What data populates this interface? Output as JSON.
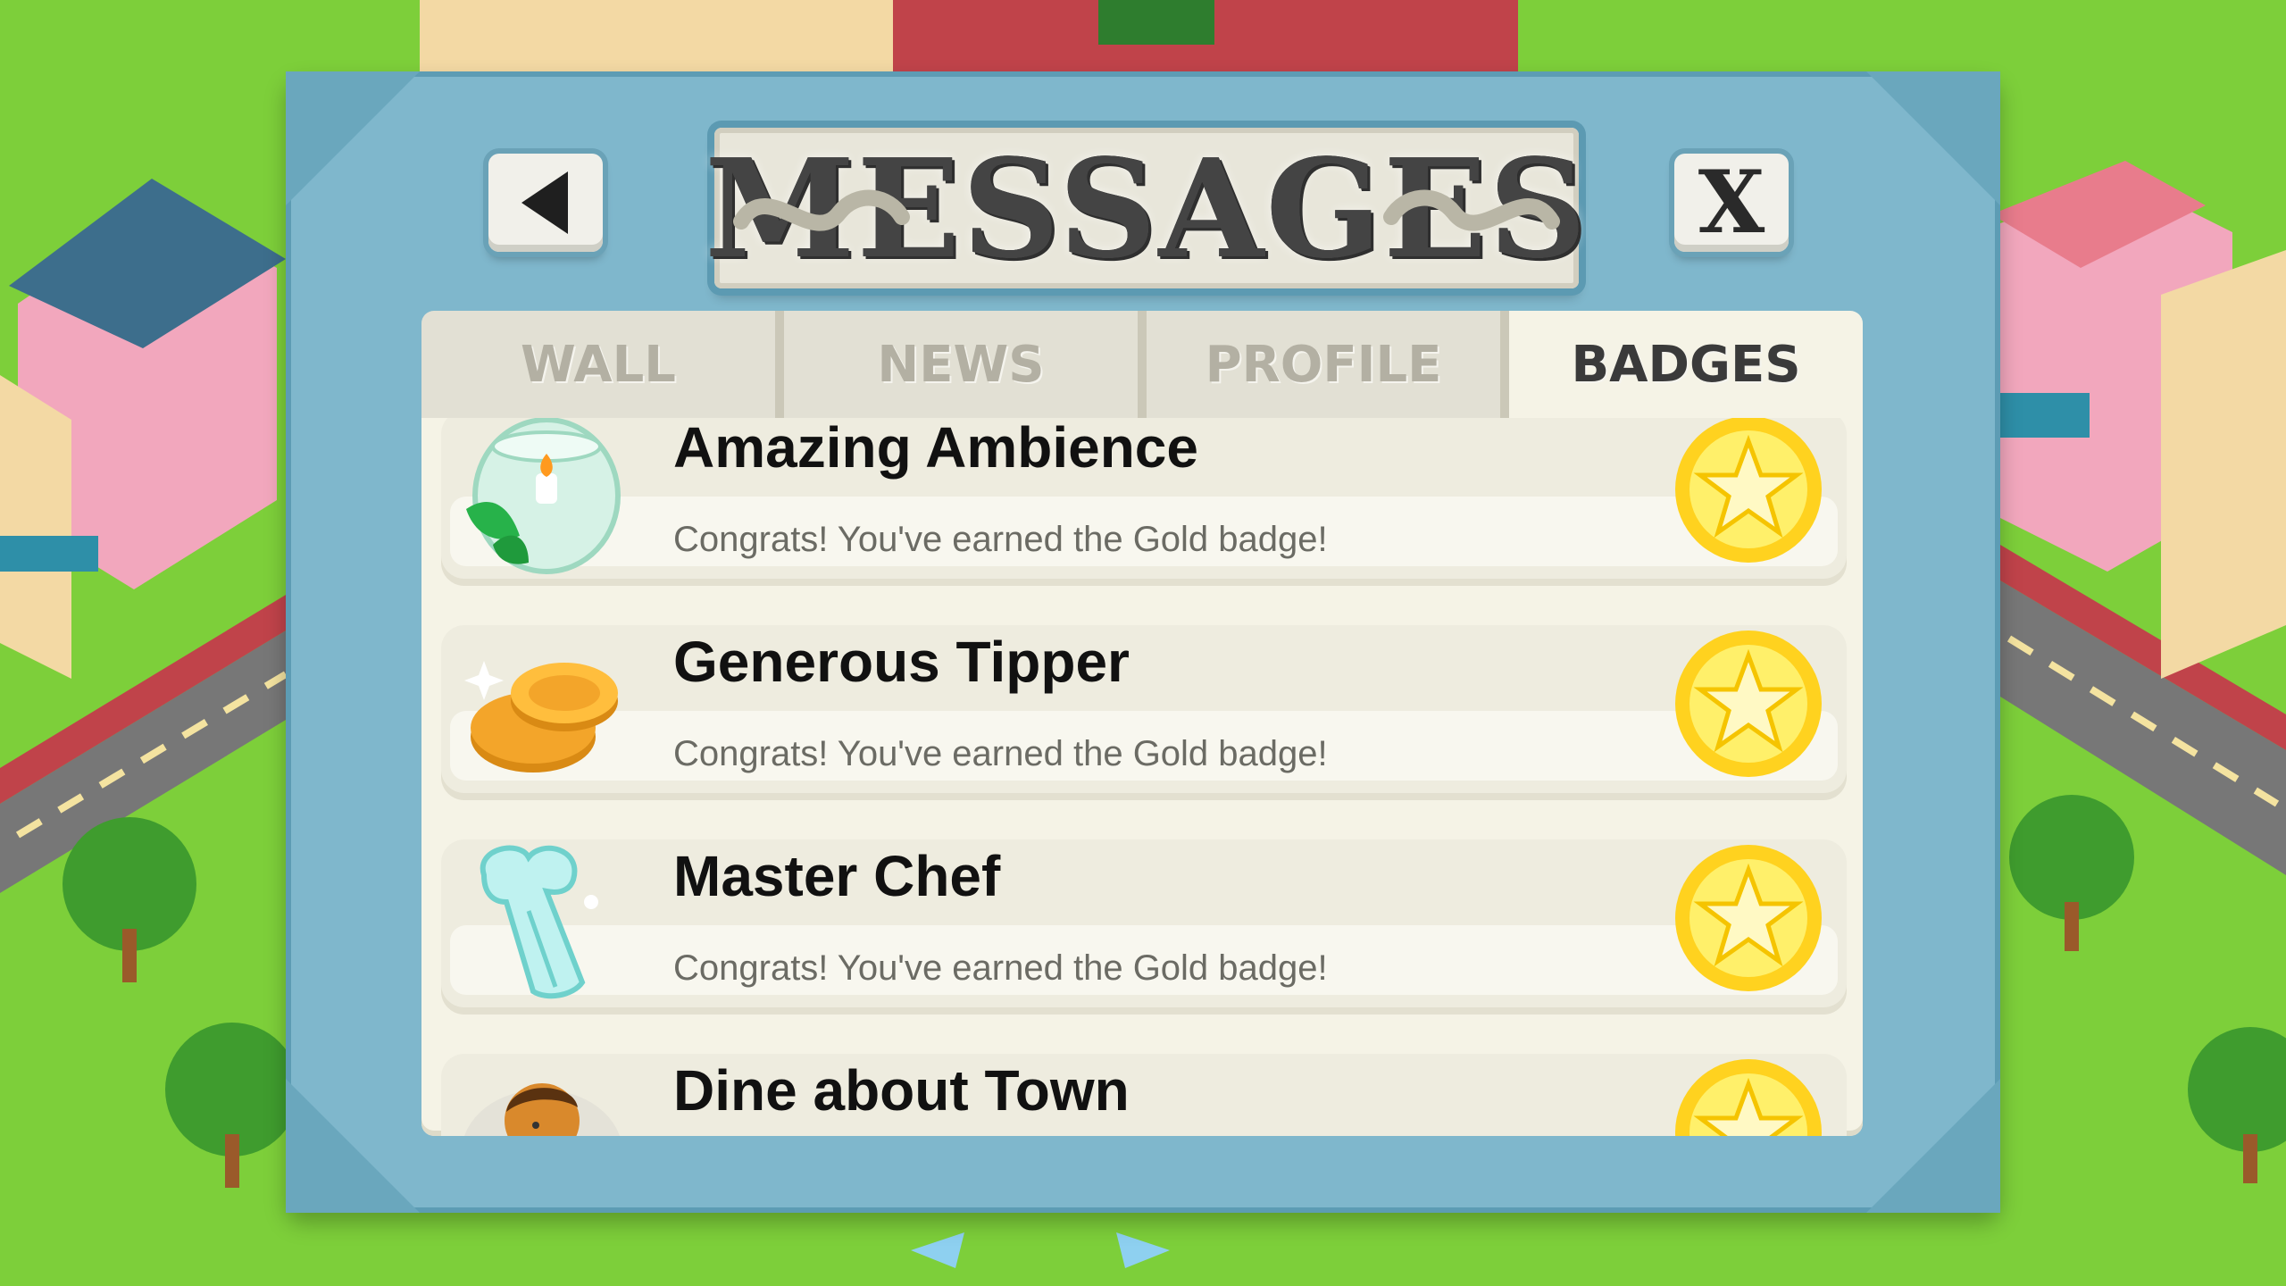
{
  "header": {
    "title": "MESSAGES",
    "back_icon": "back-arrow-icon",
    "close_label": "X"
  },
  "tabs": [
    {
      "label": "WALL",
      "active": false
    },
    {
      "label": "NEWS",
      "active": false
    },
    {
      "label": "PROFILE",
      "active": false
    },
    {
      "label": "BADGES",
      "active": true
    }
  ],
  "badges": [
    {
      "title": "Amazing Ambience",
      "message": "Congrats! You've earned the Gold badge!",
      "icon": "candle-bowl-icon"
    },
    {
      "title": "Generous Tipper",
      "message": "Congrats! You've earned the Gold badge!",
      "icon": "coins-icon"
    },
    {
      "title": "Master Chef",
      "message": "Congrats! You've earned the Gold badge!",
      "icon": "chef-hat-icon"
    },
    {
      "title": "Dine about Town",
      "message": "",
      "icon": "diner-avatar-icon"
    }
  ],
  "colors": {
    "panel": "#7fb7cc",
    "grass": "#7dcf3a",
    "gold": "#ffd21f",
    "active_tab": "#f5f3e6"
  }
}
